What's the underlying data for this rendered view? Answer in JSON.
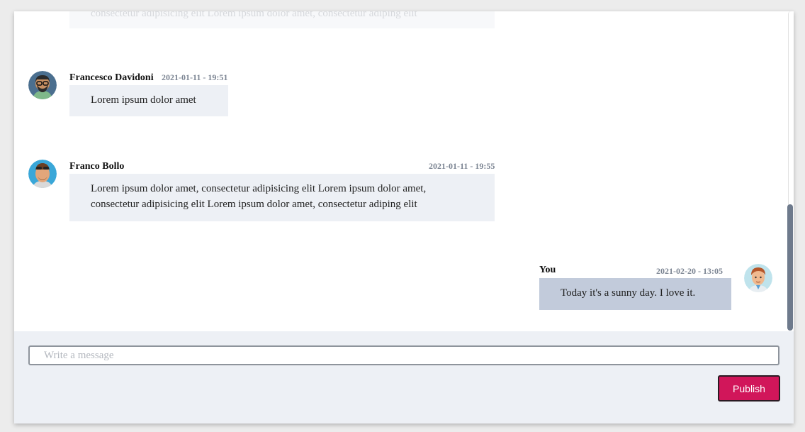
{
  "messages": [
    {
      "author": "",
      "time": "",
      "text": "consectetur adipisicing elit Lorem ipsum dolor amet, consectetur adiping elit",
      "faded": true
    },
    {
      "author": "Francesco Davidoni",
      "time": "2021-01-11 - 19:51",
      "text": "Lorem ipsum dolor amet",
      "avatar_icon": "bearded-man-glasses-avatar"
    },
    {
      "author": "Franco Bollo",
      "time": "2021-01-11 - 19:55",
      "text": "Lorem ipsum dolor amet, consectetur adipisicing elit Lorem ipsum dolor amet, consectetur adipisicing elit Lorem ipsum dolor amet, consectetur adiping elit",
      "line1": "Lorem ipsum dolor amet, consectetur adipisicing elit Lorem ipsum dolor amet,",
      "line2": "consectetur adipisicing elit Lorem ipsum dolor amet, consectetur adiping elit",
      "avatar_icon": "man-sunglasses-on-head-avatar"
    },
    {
      "author": "You",
      "time": "2021-02-20 - 13:05",
      "text": "Today it's a sunny day. I love it.",
      "avatar_icon": "red-haired-man-avatar",
      "mine": true
    }
  ],
  "composer": {
    "placeholder": "Write a message",
    "value": "",
    "publish_label": "Publish"
  },
  "colors": {
    "accent": "#d1165a",
    "bubble": "#edf0f5",
    "bubble_mine": "#c2cbdb",
    "timestamp": "#7c8593"
  }
}
